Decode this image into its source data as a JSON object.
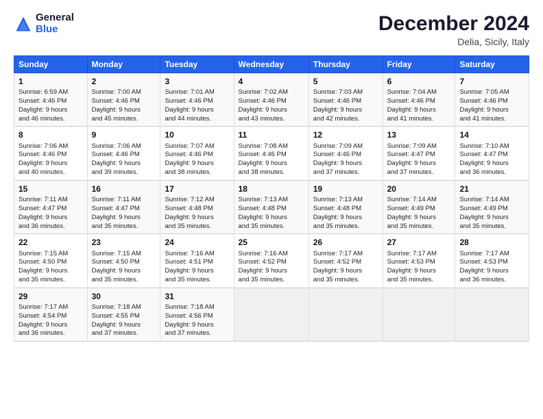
{
  "header": {
    "logo_line1": "General",
    "logo_line2": "Blue",
    "month": "December 2024",
    "location": "Delia, Sicily, Italy"
  },
  "days_of_week": [
    "Sunday",
    "Monday",
    "Tuesday",
    "Wednesday",
    "Thursday",
    "Friday",
    "Saturday"
  ],
  "weeks": [
    [
      {
        "day": "1",
        "lines": [
          "Sunrise: 6:59 AM",
          "Sunset: 4:46 PM",
          "Daylight: 9 hours",
          "and 46 minutes."
        ]
      },
      {
        "day": "2",
        "lines": [
          "Sunrise: 7:00 AM",
          "Sunset: 4:46 PM",
          "Daylight: 9 hours",
          "and 45 minutes."
        ]
      },
      {
        "day": "3",
        "lines": [
          "Sunrise: 7:01 AM",
          "Sunset: 4:46 PM",
          "Daylight: 9 hours",
          "and 44 minutes."
        ]
      },
      {
        "day": "4",
        "lines": [
          "Sunrise: 7:02 AM",
          "Sunset: 4:46 PM",
          "Daylight: 9 hours",
          "and 43 minutes."
        ]
      },
      {
        "day": "5",
        "lines": [
          "Sunrise: 7:03 AM",
          "Sunset: 4:46 PM",
          "Daylight: 9 hours",
          "and 42 minutes."
        ]
      },
      {
        "day": "6",
        "lines": [
          "Sunrise: 7:04 AM",
          "Sunset: 4:46 PM",
          "Daylight: 9 hours",
          "and 41 minutes."
        ]
      },
      {
        "day": "7",
        "lines": [
          "Sunrise: 7:05 AM",
          "Sunset: 4:46 PM",
          "Daylight: 9 hours",
          "and 41 minutes."
        ]
      }
    ],
    [
      {
        "day": "8",
        "lines": [
          "Sunrise: 7:06 AM",
          "Sunset: 4:46 PM",
          "Daylight: 9 hours",
          "and 40 minutes."
        ]
      },
      {
        "day": "9",
        "lines": [
          "Sunrise: 7:06 AM",
          "Sunset: 4:46 PM",
          "Daylight: 9 hours",
          "and 39 minutes."
        ]
      },
      {
        "day": "10",
        "lines": [
          "Sunrise: 7:07 AM",
          "Sunset: 4:46 PM",
          "Daylight: 9 hours",
          "and 38 minutes."
        ]
      },
      {
        "day": "11",
        "lines": [
          "Sunrise: 7:08 AM",
          "Sunset: 4:46 PM",
          "Daylight: 9 hours",
          "and 38 minutes."
        ]
      },
      {
        "day": "12",
        "lines": [
          "Sunrise: 7:09 AM",
          "Sunset: 4:46 PM",
          "Daylight: 9 hours",
          "and 37 minutes."
        ]
      },
      {
        "day": "13",
        "lines": [
          "Sunrise: 7:09 AM",
          "Sunset: 4:47 PM",
          "Daylight: 9 hours",
          "and 37 minutes."
        ]
      },
      {
        "day": "14",
        "lines": [
          "Sunrise: 7:10 AM",
          "Sunset: 4:47 PM",
          "Daylight: 9 hours",
          "and 36 minutes."
        ]
      }
    ],
    [
      {
        "day": "15",
        "lines": [
          "Sunrise: 7:11 AM",
          "Sunset: 4:47 PM",
          "Daylight: 9 hours",
          "and 36 minutes."
        ]
      },
      {
        "day": "16",
        "lines": [
          "Sunrise: 7:11 AM",
          "Sunset: 4:47 PM",
          "Daylight: 9 hours",
          "and 35 minutes."
        ]
      },
      {
        "day": "17",
        "lines": [
          "Sunrise: 7:12 AM",
          "Sunset: 4:48 PM",
          "Daylight: 9 hours",
          "and 35 minutes."
        ]
      },
      {
        "day": "18",
        "lines": [
          "Sunrise: 7:13 AM",
          "Sunset: 4:48 PM",
          "Daylight: 9 hours",
          "and 35 minutes."
        ]
      },
      {
        "day": "19",
        "lines": [
          "Sunrise: 7:13 AM",
          "Sunset: 4:48 PM",
          "Daylight: 9 hours",
          "and 35 minutes."
        ]
      },
      {
        "day": "20",
        "lines": [
          "Sunrise: 7:14 AM",
          "Sunset: 4:49 PM",
          "Daylight: 9 hours",
          "and 35 minutes."
        ]
      },
      {
        "day": "21",
        "lines": [
          "Sunrise: 7:14 AM",
          "Sunset: 4:49 PM",
          "Daylight: 9 hours",
          "and 35 minutes."
        ]
      }
    ],
    [
      {
        "day": "22",
        "lines": [
          "Sunrise: 7:15 AM",
          "Sunset: 4:50 PM",
          "Daylight: 9 hours",
          "and 35 minutes."
        ]
      },
      {
        "day": "23",
        "lines": [
          "Sunrise: 7:15 AM",
          "Sunset: 4:50 PM",
          "Daylight: 9 hours",
          "and 35 minutes."
        ]
      },
      {
        "day": "24",
        "lines": [
          "Sunrise: 7:16 AM",
          "Sunset: 4:51 PM",
          "Daylight: 9 hours",
          "and 35 minutes."
        ]
      },
      {
        "day": "25",
        "lines": [
          "Sunrise: 7:16 AM",
          "Sunset: 4:52 PM",
          "Daylight: 9 hours",
          "and 35 minutes."
        ]
      },
      {
        "day": "26",
        "lines": [
          "Sunrise: 7:17 AM",
          "Sunset: 4:52 PM",
          "Daylight: 9 hours",
          "and 35 minutes."
        ]
      },
      {
        "day": "27",
        "lines": [
          "Sunrise: 7:17 AM",
          "Sunset: 4:53 PM",
          "Daylight: 9 hours",
          "and 35 minutes."
        ]
      },
      {
        "day": "28",
        "lines": [
          "Sunrise: 7:17 AM",
          "Sunset: 4:53 PM",
          "Daylight: 9 hours",
          "and 36 minutes."
        ]
      }
    ],
    [
      {
        "day": "29",
        "lines": [
          "Sunrise: 7:17 AM",
          "Sunset: 4:54 PM",
          "Daylight: 9 hours",
          "and 36 minutes."
        ]
      },
      {
        "day": "30",
        "lines": [
          "Sunrise: 7:18 AM",
          "Sunset: 4:55 PM",
          "Daylight: 9 hours",
          "and 37 minutes."
        ]
      },
      {
        "day": "31",
        "lines": [
          "Sunrise: 7:18 AM",
          "Sunset: 4:56 PM",
          "Daylight: 9 hours",
          "and 37 minutes."
        ]
      },
      null,
      null,
      null,
      null
    ]
  ]
}
